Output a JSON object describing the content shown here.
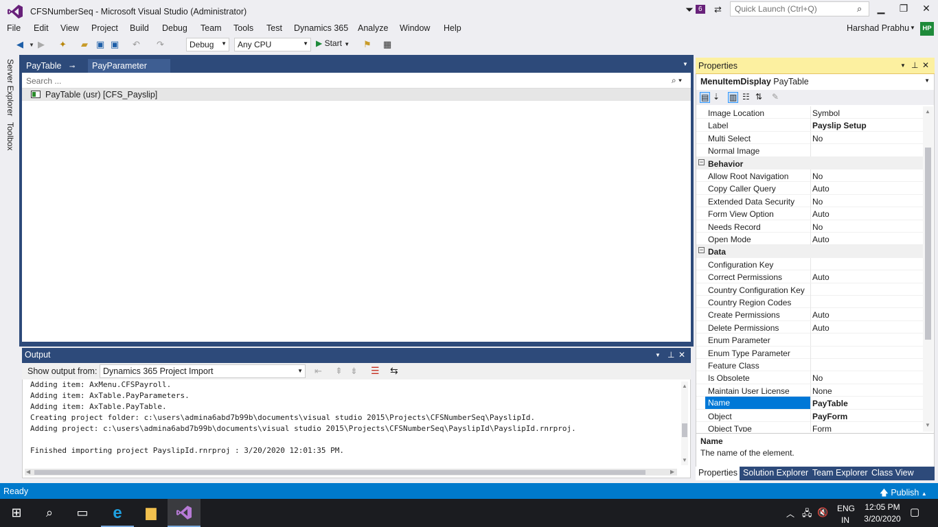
{
  "window": {
    "title": "CFSNumberSeq - Microsoft Visual Studio (Administrator)",
    "notification_count": "6",
    "quick_launch_placeholder": "Quick Launch (Ctrl+Q)"
  },
  "menu": {
    "items": [
      "File",
      "Edit",
      "View",
      "Project",
      "Build",
      "Debug",
      "Team",
      "Tools",
      "Test",
      "Dynamics 365",
      "Analyze",
      "Window",
      "Help"
    ],
    "user_name": "Harshad Prabhu",
    "user_initials": "HP"
  },
  "toolbar": {
    "config": "Debug",
    "platform": "Any CPU",
    "start_label": "Start"
  },
  "side_tabs": [
    "Server Explorer",
    "Toolbox"
  ],
  "documents": {
    "tabs": [
      {
        "label": "PayTable",
        "active": true
      },
      {
        "label": "PayParameter",
        "active": false
      }
    ],
    "search_placeholder": "Search ...",
    "tree_item": "PayTable (usr) [CFS_Payslip]"
  },
  "output": {
    "title": "Output",
    "show_from_label": "Show output from:",
    "source": "Dynamics 365 Project Import",
    "lines": [
      "Adding item: AxMenu.CFSPayroll.",
      "Adding item: AxTable.PayParameters.",
      "Adding item: AxTable.PayTable.",
      "Creating project folder: c:\\users\\admina6abd7b99b\\documents\\visual studio 2015\\Projects\\CFSNumberSeq\\PayslipId.",
      "Adding project: c:\\users\\admina6abd7b99b\\documents\\visual studio 2015\\Projects\\CFSNumberSeq\\PayslipId\\PayslipId.rnrproj.",
      "",
      "Finished importing project PayslipId.rnrproj : 3/20/2020 12:01:35 PM."
    ]
  },
  "properties": {
    "title": "Properties",
    "object_type": "MenuItemDisplay",
    "object_name": "PayTable",
    "rows": [
      {
        "name": "Image Location",
        "value": "Symbol"
      },
      {
        "name": "Label",
        "value": "Payslip Setup",
        "bold": true
      },
      {
        "name": "Multi Select",
        "value": "No"
      },
      {
        "name": "Normal Image",
        "value": ""
      },
      {
        "name": "Behavior",
        "category": true
      },
      {
        "name": "Allow Root Navigation",
        "value": "No"
      },
      {
        "name": "Copy Caller Query",
        "value": "Auto"
      },
      {
        "name": "Extended Data Security",
        "value": "No"
      },
      {
        "name": "Form View Option",
        "value": "Auto"
      },
      {
        "name": "Needs Record",
        "value": "No"
      },
      {
        "name": "Open Mode",
        "value": "Auto"
      },
      {
        "name": "Data",
        "category": true
      },
      {
        "name": "Configuration Key",
        "value": ""
      },
      {
        "name": "Correct Permissions",
        "value": "Auto"
      },
      {
        "name": "Country Configuration Key",
        "value": ""
      },
      {
        "name": "Country Region Codes",
        "value": ""
      },
      {
        "name": "Create Permissions",
        "value": "Auto"
      },
      {
        "name": "Delete Permissions",
        "value": "Auto"
      },
      {
        "name": "Enum Parameter",
        "value": ""
      },
      {
        "name": "Enum Type Parameter",
        "value": ""
      },
      {
        "name": "Feature Class",
        "value": ""
      },
      {
        "name": "Is Obsolete",
        "value": "No"
      },
      {
        "name": "Maintain User License",
        "value": "None"
      },
      {
        "name": "Name",
        "value": "PayTable",
        "bold": true,
        "selected": true
      },
      {
        "name": "Object",
        "value": "PayForm",
        "bold": true
      },
      {
        "name": "Object Type",
        "value": "Form"
      }
    ],
    "desc_title": "Name",
    "desc_text": "The name of the element.",
    "bottom_tabs": [
      "Properties",
      "Solution Explorer",
      "Team Explorer",
      "Class View"
    ]
  },
  "status": {
    "text": "Ready",
    "publish": "Publish"
  },
  "taskbar": {
    "lang": "ENG",
    "region": "IN",
    "time": "12:05 PM",
    "date": "3/20/2020"
  },
  "colors": {
    "accent": "#007acc",
    "panel_dark": "#2d4a7a",
    "properties_header": "#fcf0a0",
    "vs_purple": "#68217a"
  }
}
